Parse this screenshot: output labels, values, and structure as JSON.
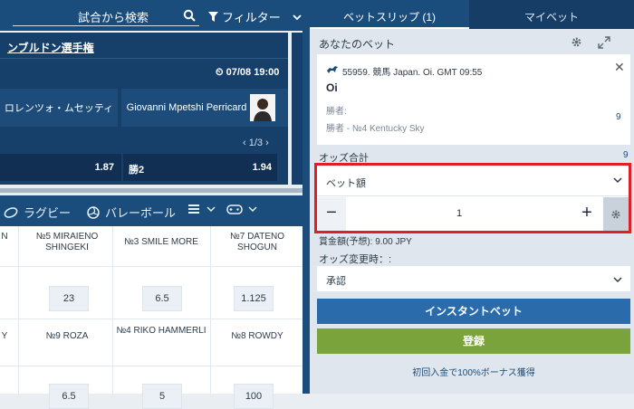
{
  "left": {
    "search_text": "試合から検索",
    "filter_label": "フィルター",
    "event_title": "ンブルドン選手権",
    "event_time": "07/08 19:00",
    "team1": "ロレンツォ・ムセッティ",
    "team2": "Giovanni Mpetshi Perricard",
    "pager": "1/3",
    "odd1_value": "1.87",
    "odd2_label": "勝2",
    "odd2_value": "1.94",
    "sports": [
      "ラグビー",
      "バレーボール"
    ],
    "grid_headers_row1": [
      "N",
      "№5 MIRAIENO SHINGEKI",
      "№3 SMILE MORE",
      "№7 DATENO SHOGUN"
    ],
    "grid_odds_row1": [
      "23",
      "6.5",
      "1.125"
    ],
    "grid_headers_row2": [
      "Y",
      "№9 ROZA",
      "№4 RIKO HAMMERLI",
      "№8 ROWDY"
    ],
    "grid_odds_row2": [
      "6.5",
      "5",
      "100"
    ]
  },
  "right": {
    "tab_betslip": "ベットスリップ (1)",
    "tab_mybets": "マイベット",
    "your_bets": "あなたのベット",
    "bet_event": "55959. 競馬 Japan. Oi. GMT 09:55",
    "bet_name": "Oi",
    "bet_market": "勝者:",
    "bet_selection": "勝者 - №4 Kentucky Sky",
    "bet_odds": "9",
    "total_odds_label": "オッズ合計",
    "total_odds_value": "9",
    "stake_label": "ベット額",
    "stake_value": "1",
    "payout": "賞金額(予想): 9.00 JPY",
    "odds_change_label": "オッズ変更時：:",
    "accept_value": "承認",
    "instant_bet": "インスタントベット",
    "register": "登録",
    "bonus": "初回入金で100%ボーナス獲得"
  },
  "colors": {
    "header_blue": "#1a4c7c",
    "highlight_red": "#e01e26",
    "register_green": "#7ba33c",
    "instant_blue": "#2a6bac"
  }
}
